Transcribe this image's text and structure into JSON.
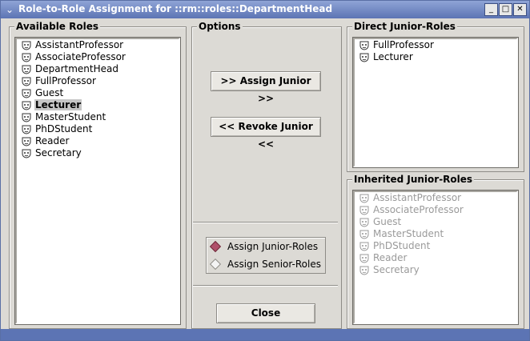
{
  "window": {
    "title": "Role-to-Role Assignment for ::rm::roles::DepartmentHead",
    "menu_glyph": "⌄",
    "minimize_glyph": "_",
    "maximize_glyph": "□",
    "close_glyph": "✕"
  },
  "available_roles": {
    "label": "Available Roles",
    "items": [
      {
        "label": "AssistantProfessor",
        "selected": false
      },
      {
        "label": "AssociateProfessor",
        "selected": false
      },
      {
        "label": "DepartmentHead",
        "selected": false
      },
      {
        "label": "FullProfessor",
        "selected": false
      },
      {
        "label": "Guest",
        "selected": false
      },
      {
        "label": "Lecturer",
        "selected": true
      },
      {
        "label": "MasterStudent",
        "selected": false
      },
      {
        "label": "PhDStudent",
        "selected": false
      },
      {
        "label": "Reader",
        "selected": false
      },
      {
        "label": "Secretary",
        "selected": false
      }
    ]
  },
  "options": {
    "label": "Options",
    "assign_button": ">> Assign Junior >>",
    "revoke_button": "<< Revoke Junior <<",
    "radio": [
      {
        "label": "Assign Junior-Roles",
        "checked": true
      },
      {
        "label": "Assign Senior-Roles",
        "checked": false
      }
    ],
    "close_button": "Close"
  },
  "direct_junior_roles": {
    "label": "Direct Junior-Roles",
    "items": [
      {
        "label": "FullProfessor"
      },
      {
        "label": "Lecturer"
      }
    ]
  },
  "inherited_junior_roles": {
    "label": "Inherited Junior-Roles",
    "items": [
      {
        "label": "AssistantProfessor"
      },
      {
        "label": "AssociateProfessor"
      },
      {
        "label": "Guest"
      },
      {
        "label": "MasterStudent"
      },
      {
        "label": "PhDStudent"
      },
      {
        "label": "Reader"
      },
      {
        "label": "Secretary"
      }
    ]
  },
  "colors": {
    "titlebar": "#5c74b4",
    "window_bg": "#dcdad5",
    "radio_checked": "#b0506a",
    "disabled_text": "#9a9a9a"
  },
  "icons": {
    "role_item": "role-mask-icon"
  }
}
